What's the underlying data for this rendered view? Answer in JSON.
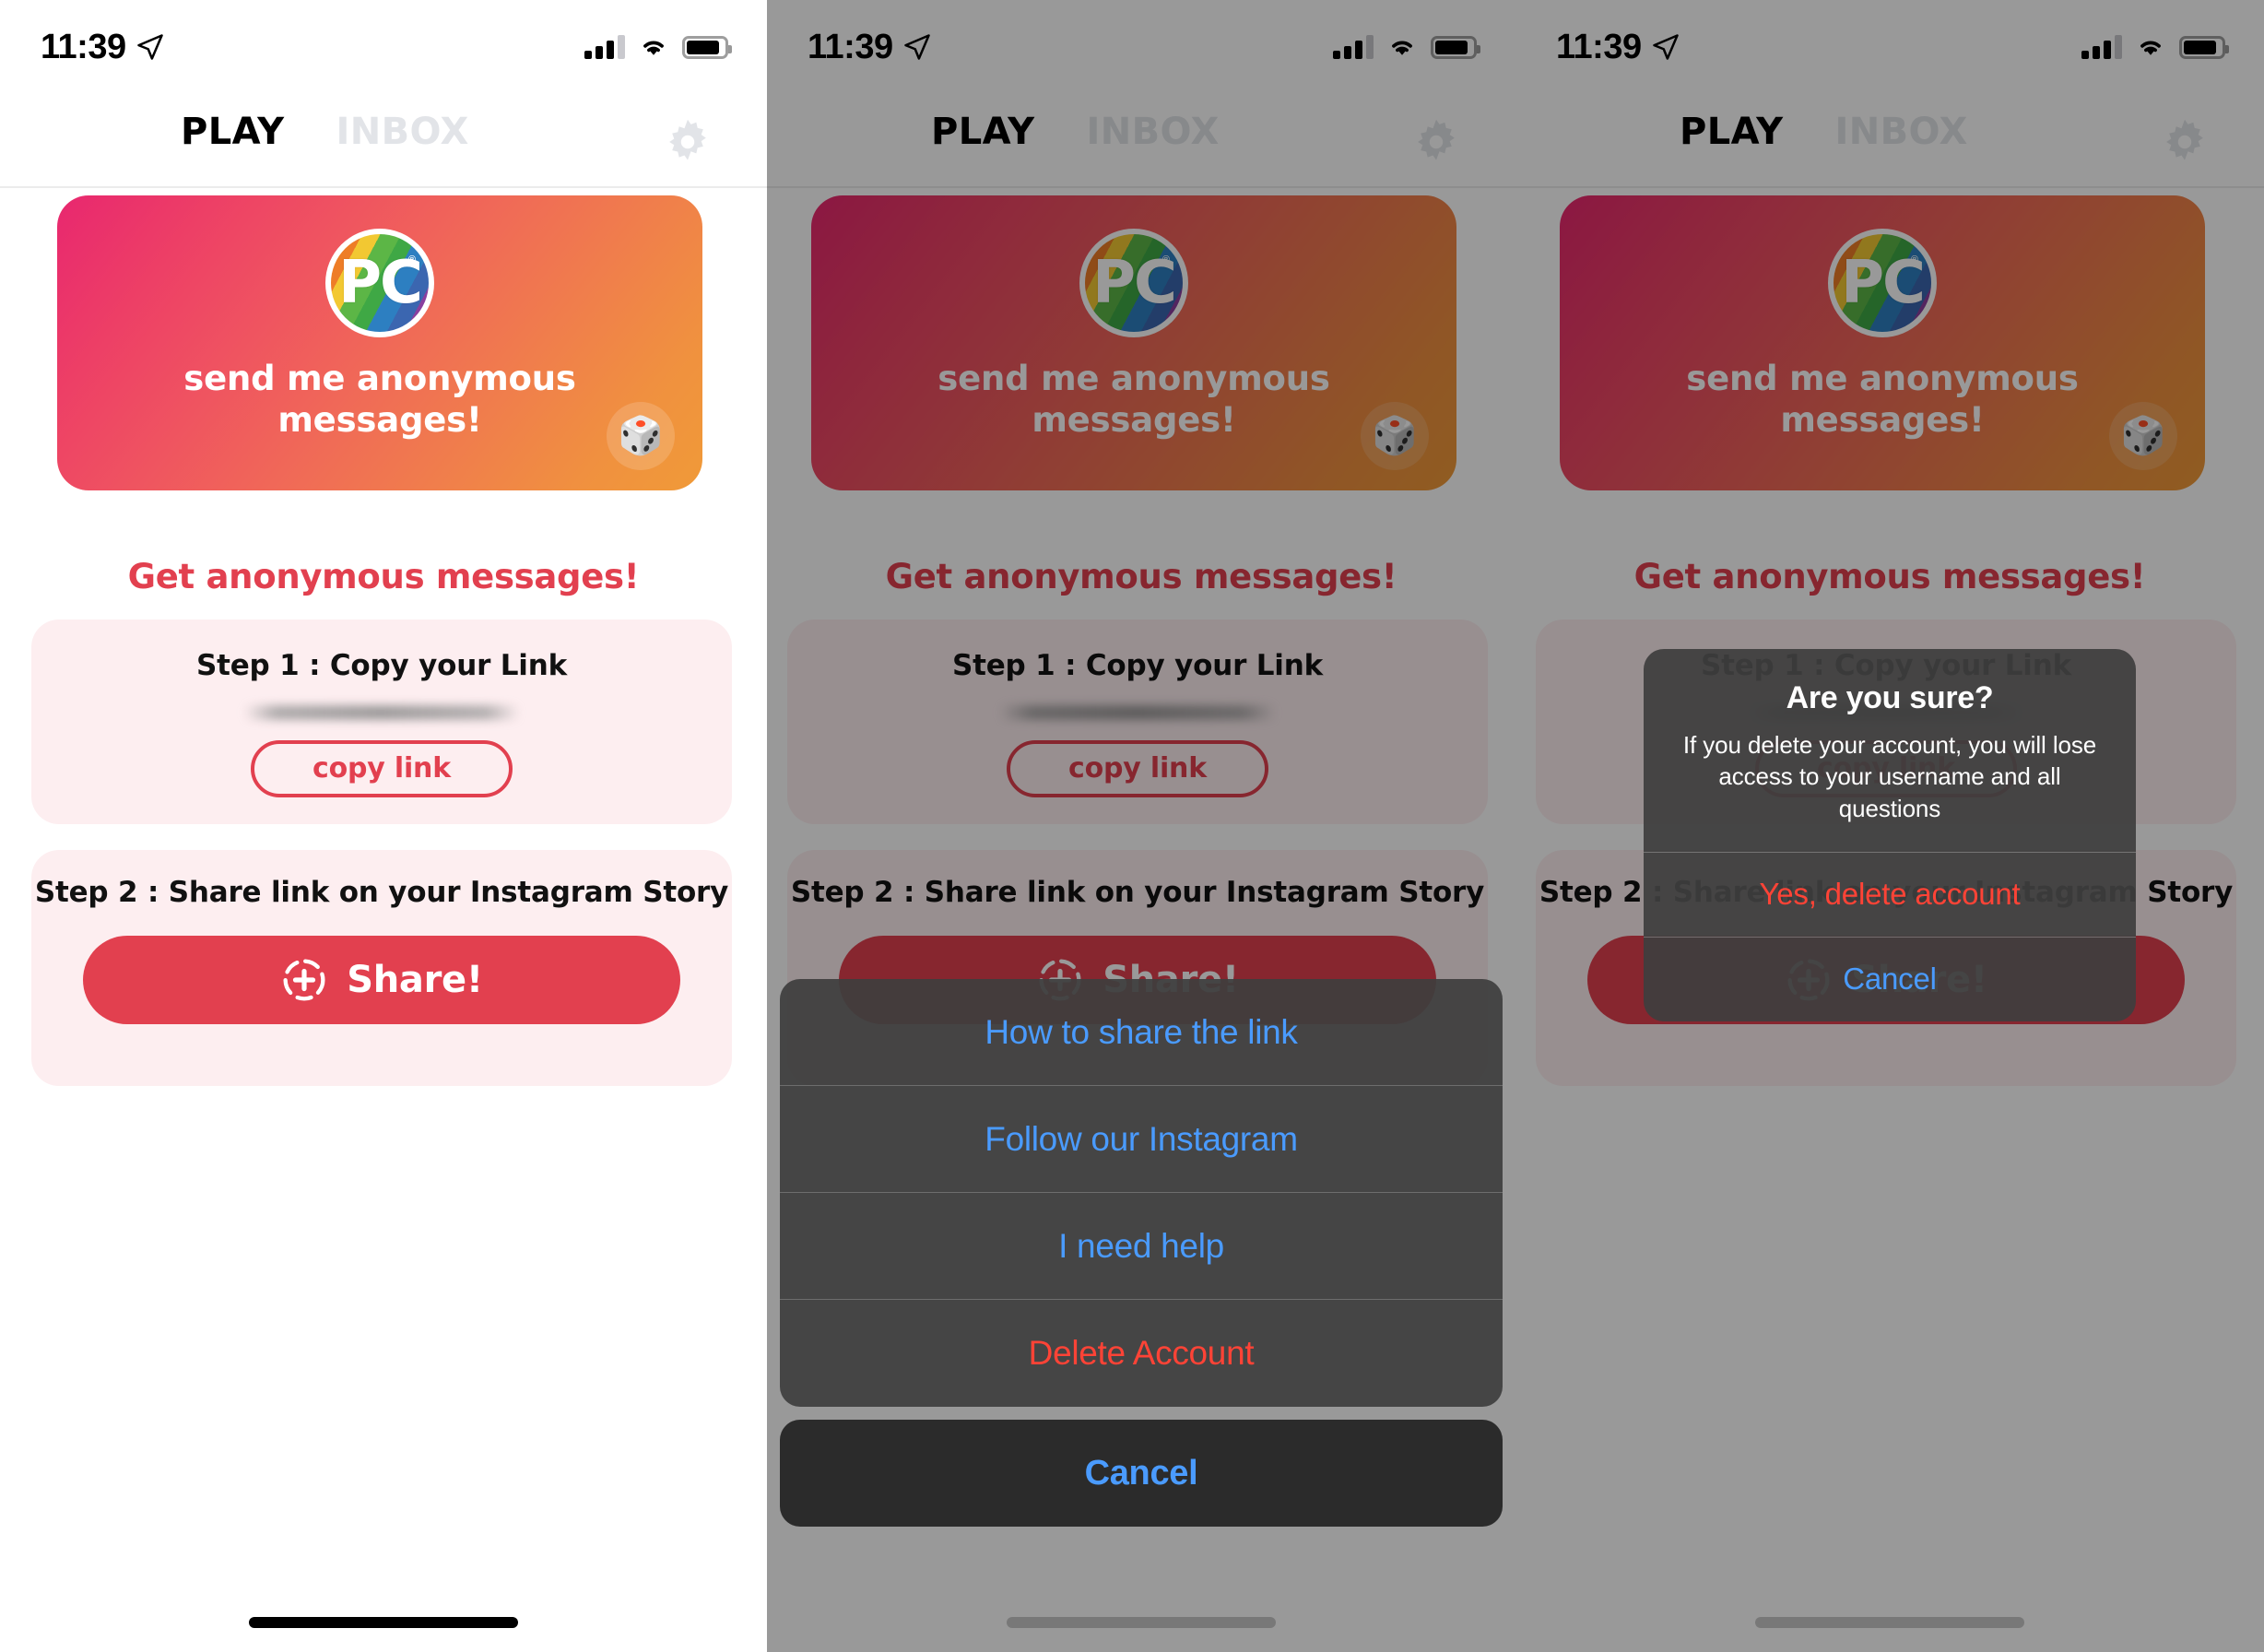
{
  "status_bar": {
    "time": "11:39",
    "location_icon": "location-arrow-icon",
    "cellular_icon": "cellular-signal-icon",
    "wifi_icon": "wifi-icon",
    "battery_icon": "battery-icon"
  },
  "nav": {
    "tab_play": "PLAY",
    "tab_inbox": "INBOX",
    "settings_icon": "gear-icon",
    "active_tab": "PLAY"
  },
  "hero": {
    "logo_text": "PC",
    "logo_trademark": "®",
    "prompt": "send me anonymous messages!",
    "dice_icon": "🎲"
  },
  "section": {
    "heading": "Get anonymous messages!"
  },
  "step1": {
    "title": "Step 1 : Copy your Link",
    "link_value": "",
    "copy_label": "copy link"
  },
  "step2": {
    "title": "Step 2 : Share link on your Instagram Story",
    "share_label": "Share!",
    "share_icon": "instagram-story-plus-icon"
  },
  "action_sheet": {
    "items": [
      {
        "label": "How to share the link",
        "style": "default"
      },
      {
        "label": "Follow our Instagram",
        "style": "default"
      },
      {
        "label": "I need help",
        "style": "default"
      },
      {
        "label": "Delete Account",
        "style": "destructive"
      }
    ],
    "cancel_label": "Cancel"
  },
  "alert": {
    "title": "Are you sure?",
    "message": "If you delete your account, you will lose access to your username and all questions",
    "confirm_label": "Yes, delete account",
    "cancel_label": "Cancel"
  },
  "colors": {
    "accent_red": "#e2404f",
    "card_pink_bg": "#fdeef0",
    "hero_gradient_start": "#e8276f",
    "hero_gradient_end": "#f09a38",
    "ios_blue": "#4a9bff",
    "ios_destructive": "#ff4336",
    "inactive_tab": "#e2e4e8"
  }
}
